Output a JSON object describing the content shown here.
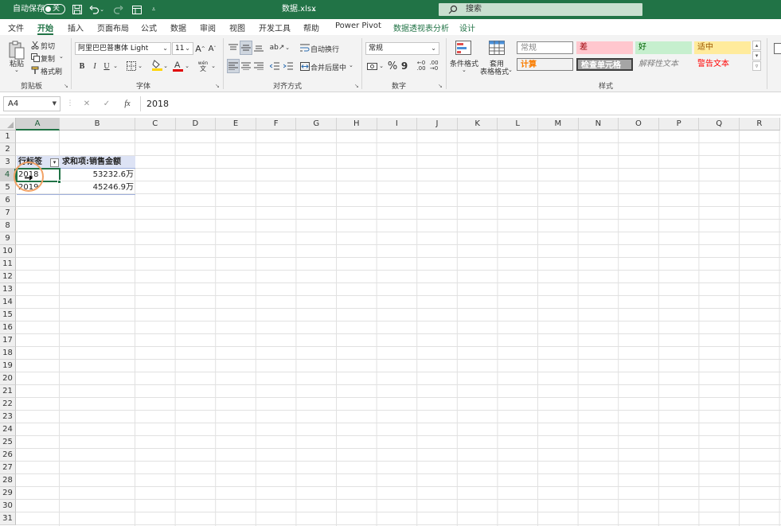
{
  "titlebar": {
    "autosave_label": "自动保存",
    "autosave_state": "关",
    "filename": "数据.xlsx",
    "filename_caret": "⌄",
    "search_placeholder": "搜索",
    "bg_color": "#217346"
  },
  "tabs": [
    {
      "label": "文件"
    },
    {
      "label": "开始"
    },
    {
      "label": "插入"
    },
    {
      "label": "页面布局"
    },
    {
      "label": "公式"
    },
    {
      "label": "数据"
    },
    {
      "label": "审阅"
    },
    {
      "label": "视图"
    },
    {
      "label": "开发工具"
    },
    {
      "label": "帮助"
    },
    {
      "label": "Power Pivot"
    },
    {
      "label": "数据透视表分析"
    },
    {
      "label": "设计"
    }
  ],
  "ribbon": {
    "clipboard": {
      "paste": "粘贴",
      "cut": "剪切",
      "copy": "复制",
      "format_painter": "格式刷",
      "group_label": "剪贴板"
    },
    "font": {
      "font_name": "阿里巴巴普惠体 Light",
      "font_size": "11",
      "bold": "B",
      "italic": "I",
      "underline": "U",
      "group_label": "字体"
    },
    "alignment": {
      "wrap_text": "自动换行",
      "merge_center": "合并后居中",
      "group_label": "对齐方式"
    },
    "number": {
      "format": "常规",
      "percent": "%",
      "comma": "9",
      "group_label": "数字"
    },
    "styles": {
      "conditional_format": "条件格式",
      "table_format_line1": "套用",
      "table_format_line2": "表格格式",
      "cells": [
        {
          "label": "常规"
        },
        {
          "label": "差"
        },
        {
          "label": "好"
        },
        {
          "label": "适中"
        },
        {
          "label": "计算"
        },
        {
          "label": "检查单元格"
        },
        {
          "label": "解释性文本"
        },
        {
          "label": "警告文本"
        }
      ],
      "group_label": "样式"
    }
  },
  "formula_bar": {
    "name_box": "A4",
    "cancel": "✕",
    "enter": "✓",
    "fx": "fx",
    "value": "2018"
  },
  "grid": {
    "columns": [
      "A",
      "B",
      "C",
      "D",
      "E",
      "F",
      "G",
      "H",
      "I",
      "J",
      "K",
      "L",
      "M",
      "N",
      "O",
      "P",
      "Q",
      "R"
    ],
    "rows": [
      "1",
      "2",
      "3",
      "4",
      "5",
      "6",
      "7",
      "8",
      "9",
      "10",
      "11",
      "12",
      "13",
      "14",
      "15",
      "16",
      "17",
      "18",
      "19",
      "20",
      "21",
      "22",
      "23",
      "24",
      "25",
      "26",
      "27",
      "28",
      "29",
      "30",
      "31"
    ],
    "selected_cell": "A4",
    "pivot": {
      "row_label_header": "行标签",
      "value_header": "求和项:销售金额",
      "rows": [
        {
          "label": "2018",
          "value": "53232.6万"
        },
        {
          "label": "2019",
          "value": "45246.9万"
        }
      ]
    }
  }
}
